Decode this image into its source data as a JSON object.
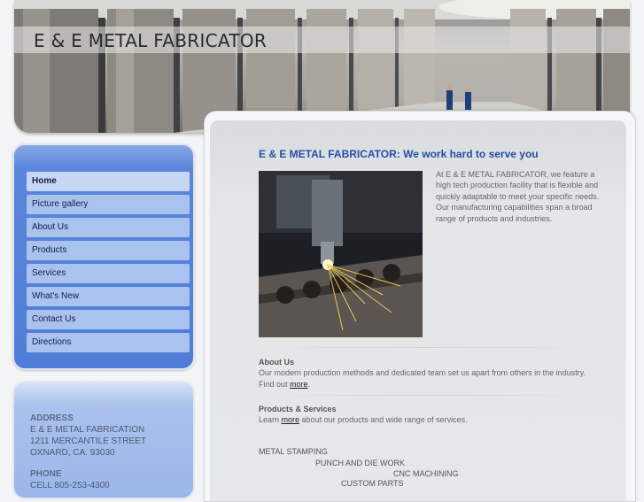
{
  "site": {
    "title": "E & E METAL FABRICATOR"
  },
  "nav": {
    "items": [
      {
        "label": "Home"
      },
      {
        "label": "Picture gallery"
      },
      {
        "label": "About Us"
      },
      {
        "label": "Products"
      },
      {
        "label": "Services"
      },
      {
        "label": "What's New"
      },
      {
        "label": "Contact Us"
      },
      {
        "label": "Directions"
      }
    ]
  },
  "address": {
    "heading": "ADDRESS",
    "line1": "E & E METAL FABRICATION",
    "line2": "1211 MERCANTILE STREET",
    "line3": "OXNARD, CA.  93030",
    "phone_heading": "PHONE",
    "phone_line": "CELL 805-253-4300"
  },
  "main": {
    "headline": "E & E METAL FABRICATOR: We work hard to serve you",
    "intro": "At E & E METAL FABRICATOR, we feature a high tech production facility that is flexible and quickly adaptable to meet your specific needs. Our manufacturing capabilities span a broad range of products and industries.",
    "about": {
      "title": "About Us",
      "text_before": "Our modern production methods and dedicated team set us apart from others in the industry. Find out ",
      "link": "more",
      "text_after": "."
    },
    "products": {
      "title": "Products & Services",
      "text_before": "Learn ",
      "link": "more",
      "text_after": " about our products and wide range of services."
    },
    "services": [
      "METAL STAMPING",
      "PUNCH AND DIE WORK",
      "CNC MACHINING",
      "CUSTOM PARTS"
    ]
  }
}
